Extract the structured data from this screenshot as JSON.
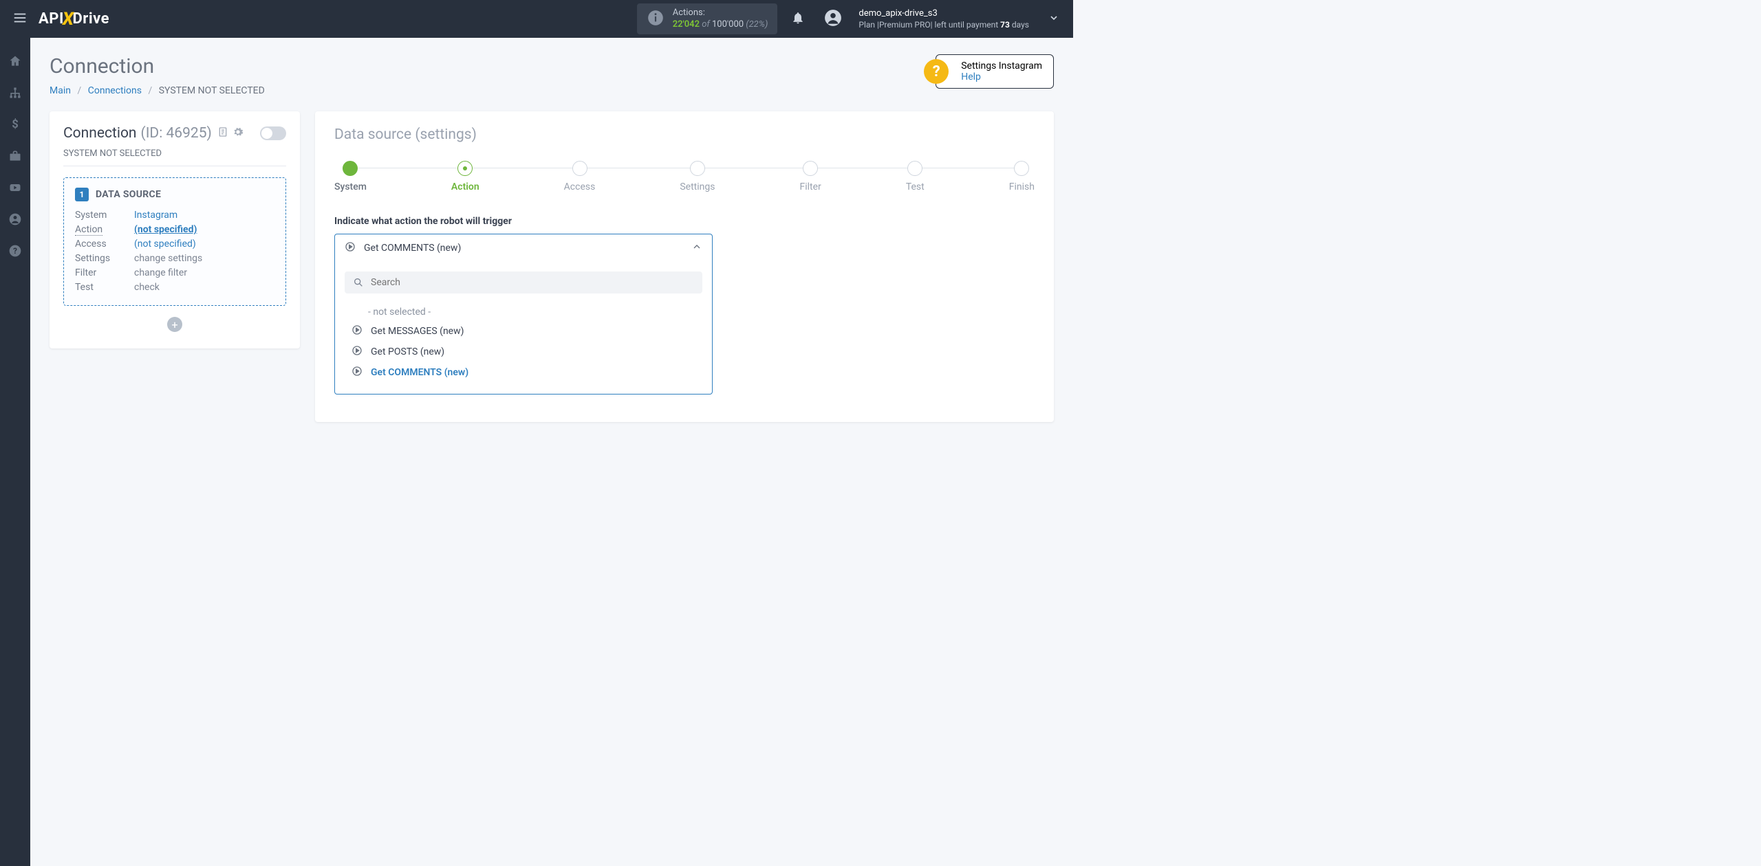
{
  "navbar": {
    "logo_prefix": "API",
    "logo_x": "X",
    "logo_suffix": "Drive",
    "actions_label": "Actions:",
    "actions_used": "22'042",
    "actions_of": " of ",
    "actions_total": "100'000",
    "actions_pct": " (22%)",
    "user": "demo_apix-drive_s3",
    "plan_prefix": "Plan ",
    "plan_name": "|Premium PRO|",
    "plan_left": " left until payment ",
    "plan_days_num": "73",
    "plan_days_word": " days"
  },
  "page": {
    "title": "Connection",
    "crumb_main": "Main",
    "crumb_conn": "Connections",
    "crumb_current": "SYSTEM NOT SELECTED"
  },
  "help": {
    "title": "Settings Instagram",
    "link": "Help"
  },
  "left": {
    "title": "Connection ",
    "id_text": "(ID: 46925)",
    "subtitle": "SYSTEM NOT SELECTED",
    "ds_badge": "1",
    "ds_title": "DATA SOURCE",
    "rows": {
      "system_label": "System",
      "system_val": "Instagram",
      "action_label": "Action",
      "action_val": "(not specified)",
      "access_label": "Access",
      "access_val": "(not specified)",
      "settings_label": "Settings",
      "settings_val": "change settings",
      "filter_label": "Filter",
      "filter_val": "change filter",
      "test_label": "Test",
      "test_val": "check"
    },
    "add_label": "+"
  },
  "right": {
    "heading": "Data source ",
    "heading_sub": "(settings)",
    "steps": [
      "System",
      "Action",
      "Access",
      "Settings",
      "Filter",
      "Test",
      "Finish"
    ],
    "field_label": "Indicate what action the robot will trigger",
    "selected": "Get COMMENTS (new)",
    "search_placeholder": "Search",
    "options": {
      "not_selected": "- not selected -",
      "o1": "Get MESSAGES (new)",
      "o2": "Get POSTS (new)",
      "o3": "Get COMMENTS (new)"
    }
  }
}
